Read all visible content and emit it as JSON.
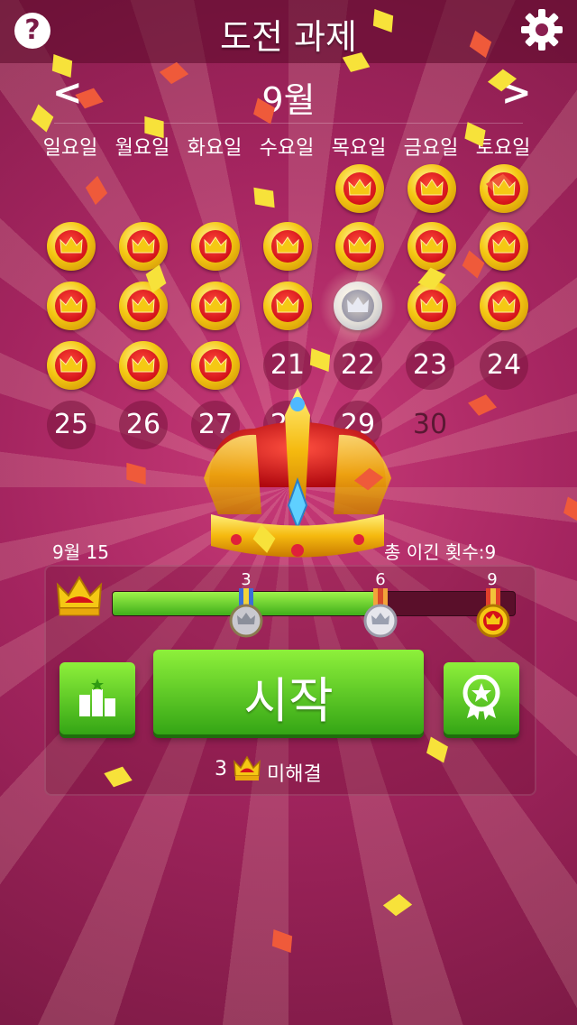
{
  "header": {
    "title": "도전 과제",
    "help_label": "?"
  },
  "calendar": {
    "month": "9월",
    "prev_label": "<",
    "next_label": ">",
    "weekdays": [
      "일요일",
      "월요일",
      "화요일",
      "수요일",
      "목요일",
      "금요일",
      "토요일"
    ],
    "remaining_days": [
      "21",
      "22",
      "23",
      "24",
      "25",
      "26",
      "27",
      "28",
      "29",
      "30"
    ]
  },
  "progress": {
    "date_label": "9월 15",
    "wins_label": "총 이긴 횟수:9",
    "milestones": [
      "3",
      "6",
      "9"
    ],
    "fill_fraction": 0.67
  },
  "actions": {
    "start_label": "시작",
    "unsolved_count": "3",
    "unsolved_label": "미해결"
  },
  "colors": {
    "accent_green": "#3fae1a",
    "coin_gold": "#f5c814",
    "coin_red": "#d4121a"
  }
}
